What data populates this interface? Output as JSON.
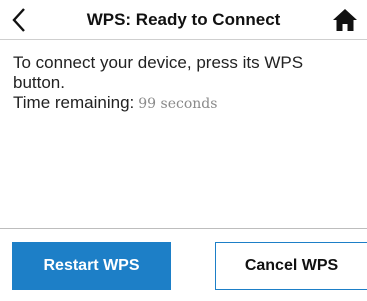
{
  "header": {
    "title": "WPS: Ready to Connect",
    "back_icon": "chevron-left-icon",
    "home_icon": "home-icon"
  },
  "message": {
    "line1": "To connect your device, press its WPS",
    "line2": "button.",
    "time_label": "Time remaining:",
    "time_value": "99 seconds"
  },
  "buttons": {
    "restart_label": "Restart WPS",
    "cancel_label": "Cancel WPS"
  },
  "colors": {
    "accent": "#1d7fc7",
    "text": "#222222",
    "muted": "#8a8a8a"
  }
}
